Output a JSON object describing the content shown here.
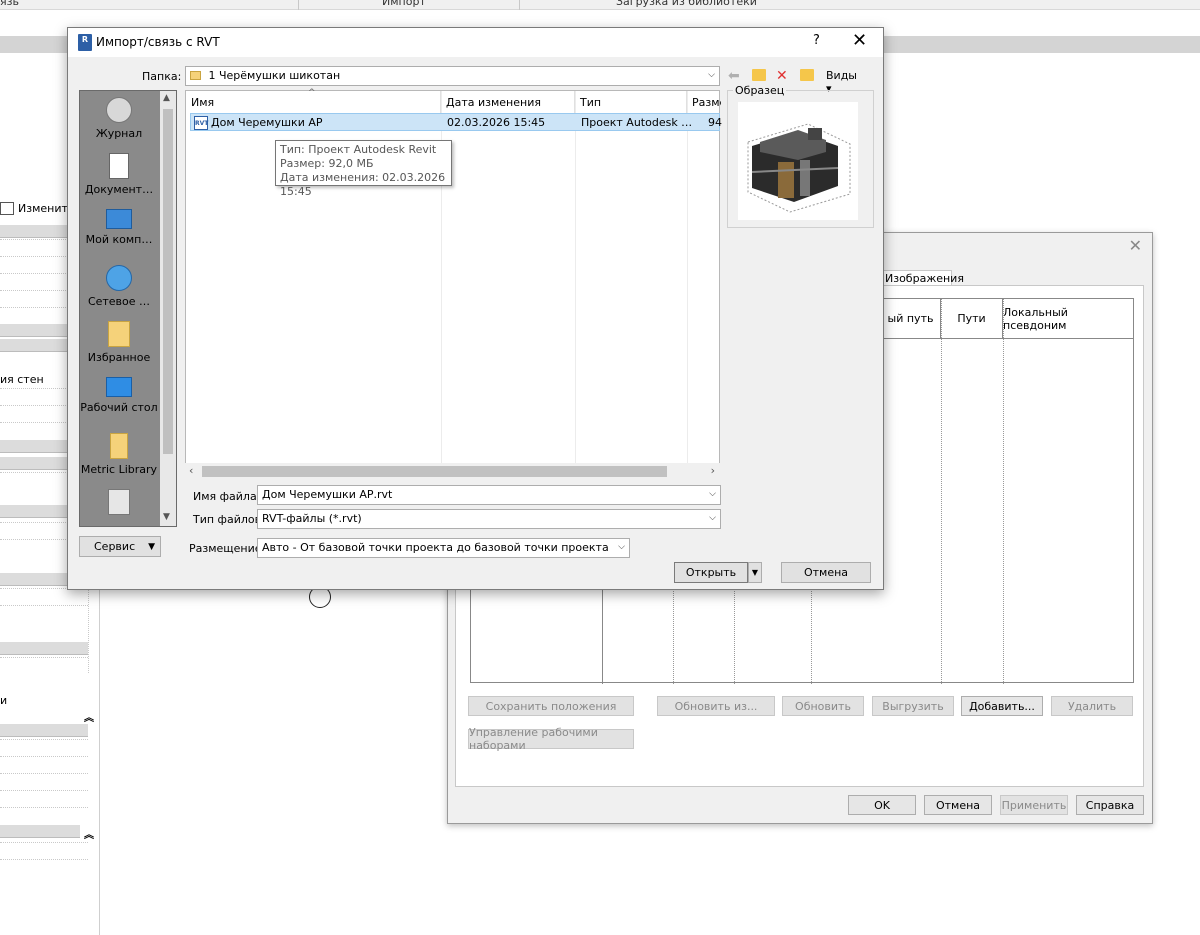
{
  "ribbon": {
    "tab_left": "язь",
    "tab_import": "Импорт",
    "tab_library": "Загрузка из библиотеки"
  },
  "left_panel": {
    "edit_label": "Изменить",
    "wall_text": "ия стен",
    "m_text": "и"
  },
  "dialog": {
    "title": "Импорт/связь с RVT",
    "help": "?",
    "close": "✕",
    "folder_label": "Папка:",
    "folder_value": "1 Черёмушки шикотан",
    "views_label": "Виды",
    "places": [
      {
        "label": "Журнал",
        "icon": "history-icon"
      },
      {
        "label": "Документ…",
        "icon": "documents-icon"
      },
      {
        "label": "Мой комп…",
        "icon": "computer-icon"
      },
      {
        "label": "Сетевое …",
        "icon": "network-icon"
      },
      {
        "label": "Избранное",
        "icon": "favorites-icon"
      },
      {
        "label": "Рабочий стол",
        "icon": "desktop-icon"
      },
      {
        "label": "Metric Library",
        "icon": "folder-icon"
      }
    ],
    "columns": [
      "Имя",
      "Дата изменения",
      "Тип",
      "Разме"
    ],
    "files": [
      {
        "name": "Дом Черемушки АР",
        "date": "02.03.2026 15:45",
        "type": "Проект Autodesk …",
        "size": "94"
      }
    ],
    "tooltip": {
      "line1": "Тип: Проект Autodesk Revit",
      "line2": "Размер: 92,0 МБ",
      "line3": "Дата изменения: 02.03.2026 15:45"
    },
    "preview_label": "Образец",
    "filename_label": "Имя файла:",
    "filename_value": "Дом Черемушки АР.rvt",
    "filetype_label": "Тип файлов:",
    "filetype_value": "RVT-файлы  (*.rvt)",
    "placement_label": "Размещение:",
    "placement_value": "Авто - От базовой точки проекта до базовой точки проекта",
    "service_button": "Сервис",
    "open_button": "Открыть",
    "cancel_button": "Отмена"
  },
  "bg_dialog": {
    "tab_images": "Изображения",
    "columns": [
      "ый путь",
      "Пути",
      "Локальный псевдоним"
    ],
    "buttons": {
      "save_positions": "Сохранить положения",
      "reload_from": "Обновить из...",
      "reload": "Обновить",
      "unload": "Выгрузить",
      "add": "Добавить...",
      "remove": "Удалить",
      "manage_worksets": "Управление рабочими наборами",
      "ok": "OK",
      "cancel": "Отмена",
      "apply": "Применить",
      "help": "Справка"
    }
  }
}
